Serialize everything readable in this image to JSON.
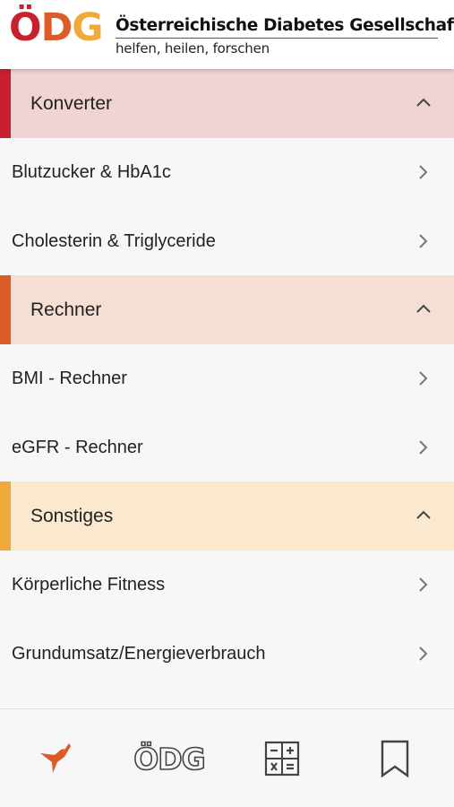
{
  "header": {
    "logo": [
      "Ö",
      "D",
      "G"
    ],
    "org_name": "Österreichische Diabetes Gesellschaft",
    "tagline": "helfen, heilen, forschen"
  },
  "sections": [
    {
      "title": "Konverter",
      "accent": "#c8202f",
      "background": "#f0d3d3",
      "items": [
        "Blutzucker & HbA1c",
        "Cholesterin & Triglyceride"
      ]
    },
    {
      "title": "Rechner",
      "accent": "#dd5b26",
      "background": "#f5dfd5",
      "items": [
        "BMI - Rechner",
        "eGFR - Rechner"
      ]
    },
    {
      "title": "Sonstiges",
      "accent": "#f0a93b",
      "background": "#fbe9cf",
      "items": [
        "Körperliche Fitness",
        "Grundumsatz/Energieverbrauch"
      ]
    }
  ],
  "bottom_nav": {
    "items": [
      {
        "icon": "hummingbird-icon",
        "color": "#dd5b26"
      },
      {
        "icon": "odg-logo-icon",
        "label": "ÖDG"
      },
      {
        "icon": "calculator-icon"
      },
      {
        "icon": "bookmark-icon"
      }
    ]
  }
}
